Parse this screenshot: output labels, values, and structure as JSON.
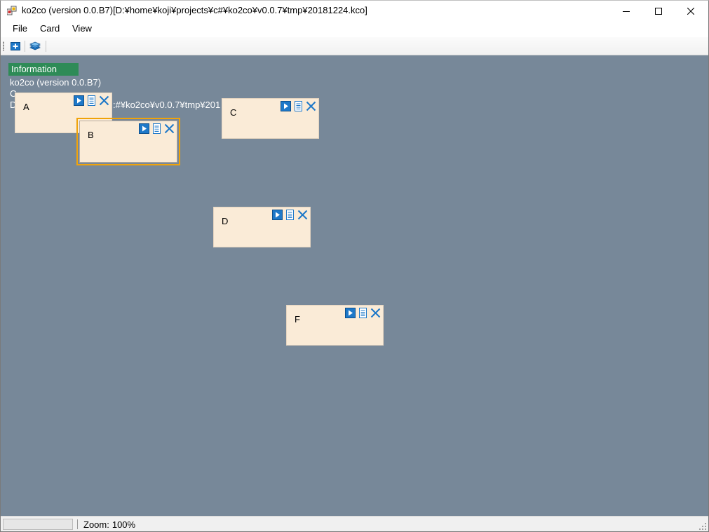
{
  "window": {
    "title": "ko2co (version 0.0.B7)[D:¥home¥koji¥projects¥c#¥ko2co¥v0.0.7¥tmp¥20181224.kco]"
  },
  "menu": {
    "file": "File",
    "card": "Card",
    "view": "View"
  },
  "toolbar": {
    "add_icon": "add-card-icon",
    "stack_icon": "stack-icon"
  },
  "info": {
    "header": "Information",
    "line1": "ko2co (version 0.0.B7)",
    "line2": "C",
    "line3": "D",
    "line3_tail": ":#¥ko2co¥v0.0.7¥tmp¥201"
  },
  "cards": [
    {
      "label": "A"
    },
    {
      "label": "B"
    },
    {
      "label": "C"
    },
    {
      "label": "D"
    },
    {
      "label": "F"
    }
  ],
  "status": {
    "zoom_label": "Zoom:",
    "zoom_value": "100%"
  },
  "colors": {
    "canvas": "#778899",
    "card": "#faebd7",
    "info_header": "#2e8b57",
    "selected_border": "#f0a30a",
    "icon_blue": "#1e78c8"
  }
}
